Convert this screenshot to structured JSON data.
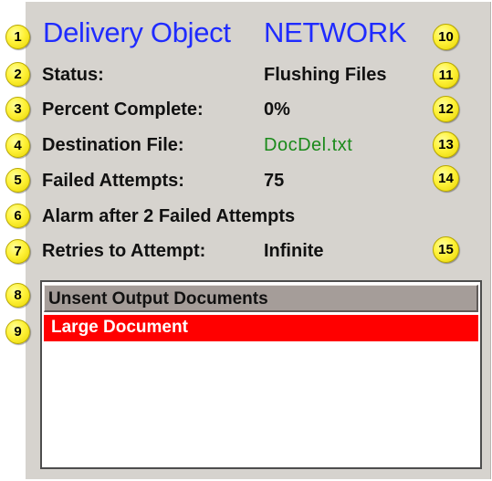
{
  "header": {
    "title": "Delivery Object",
    "object_name": "NETWORK"
  },
  "fields": {
    "status": {
      "label": "Status:",
      "value": "Flushing Files"
    },
    "percent_complete": {
      "label": "Percent Complete:",
      "value": "0%"
    },
    "destination_file": {
      "label": "Destination File:",
      "value": "DocDel.txt"
    },
    "failed_attempts": {
      "label": "Failed Attempts:",
      "value": "75"
    },
    "alarm": {
      "label": "Alarm after 2 Failed Attempts"
    },
    "retries": {
      "label": "Retries to Attempt:",
      "value": "Infinite"
    }
  },
  "document_list": {
    "header": "Unsent Output Documents",
    "items": [
      {
        "label": "Large Document",
        "selected": true
      }
    ]
  },
  "callouts": [
    "1",
    "2",
    "3",
    "4",
    "5",
    "6",
    "7",
    "8",
    "9",
    "10",
    "11",
    "12",
    "13",
    "14",
    "15"
  ],
  "colors": {
    "panel_background": "#d6d3ce",
    "title_blue": "#1f2bff",
    "destination_green": "#1a8a1a",
    "selection_red": "#ff0000",
    "list_header": "#a59d99",
    "callout_yellow": "#fff23a"
  }
}
